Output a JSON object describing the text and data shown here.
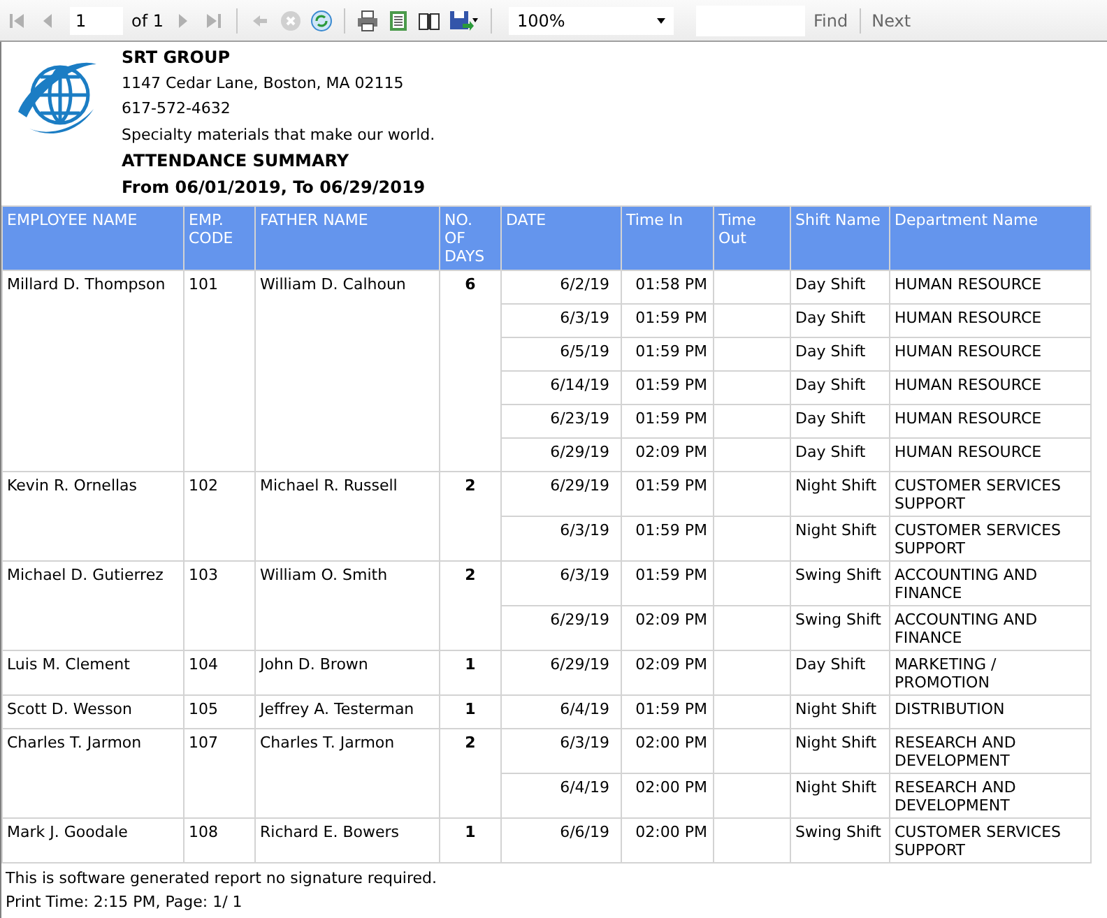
{
  "toolbar": {
    "page": "1",
    "page_count": "of 1",
    "zoom": "100%",
    "find": "Find",
    "next": "Next"
  },
  "header": {
    "company": "SRT GROUP",
    "address": "1147 Cedar Lane, Boston, MA 02115",
    "phone": "617-572-4632",
    "tagline": "Specialty materials that make our world.",
    "title": "ATTENDANCE SUMMARY",
    "period": "From 06/01/2019, To 06/29/2019"
  },
  "table": {
    "columns": [
      "EMPLOYEE NAME",
      "EMP. CODE",
      "FATHER NAME",
      "NO. OF DAYS",
      "DATE",
      "Time In",
      "Time Out",
      "Shift Name",
      "Department Name"
    ],
    "employees": [
      {
        "name": "Millard D. Thompson",
        "code": "101",
        "father": "William D. Calhoun",
        "days": "6",
        "records": [
          {
            "date": "6/2/19",
            "time_in": "01:58 PM",
            "shift": "Day Shift",
            "department": "HUMAN RESOURCE"
          },
          {
            "date": "6/3/19",
            "time_in": "01:59 PM",
            "shift": "Day Shift",
            "department": "HUMAN RESOURCE"
          },
          {
            "date": "6/5/19",
            "time_in": "01:59 PM",
            "shift": "Day Shift",
            "department": "HUMAN RESOURCE"
          },
          {
            "date": "6/14/19",
            "time_in": "01:59 PM",
            "shift": "Day Shift",
            "department": "HUMAN RESOURCE"
          },
          {
            "date": "6/23/19",
            "time_in": "01:59 PM",
            "shift": "Day Shift",
            "department": "HUMAN RESOURCE"
          },
          {
            "date": "6/29/19",
            "time_in": "02:09 PM",
            "shift": "Day Shift",
            "department": "HUMAN RESOURCE"
          }
        ]
      },
      {
        "name": "Kevin R. Ornellas",
        "code": "102",
        "father": "Michael R. Russell",
        "days": "2",
        "records": [
          {
            "date": "6/29/19",
            "time_in": "01:59 PM",
            "shift": "Night Shift",
            "department": "CUSTOMER SERVICES SUPPORT"
          },
          {
            "date": "6/3/19",
            "time_in": "01:59 PM",
            "shift": "Night Shift",
            "department": "CUSTOMER SERVICES SUPPORT"
          }
        ]
      },
      {
        "name": "Michael D. Gutierrez",
        "code": "103",
        "father": "William O. Smith",
        "days": "2",
        "records": [
          {
            "date": "6/3/19",
            "time_in": "01:59 PM",
            "shift": "Swing Shift",
            "department": "ACCOUNTING AND FINANCE"
          },
          {
            "date": "6/29/19",
            "time_in": "02:09 PM",
            "shift": "Swing Shift",
            "department": "ACCOUNTING AND FINANCE"
          }
        ]
      },
      {
        "name": "Luis M. Clement",
        "code": "104",
        "father": "John D. Brown",
        "days": "1",
        "records": [
          {
            "date": "6/29/19",
            "time_in": "02:09 PM",
            "shift": "Day Shift",
            "department": "MARKETING / PROMOTION"
          }
        ]
      },
      {
        "name": "Scott D. Wesson",
        "code": "105",
        "father": "Jeffrey A. Testerman",
        "days": "1",
        "records": [
          {
            "date": "6/4/19",
            "time_in": "01:59 PM",
            "shift": "Night Shift",
            "department": "DISTRIBUTION"
          }
        ]
      },
      {
        "name": "Charles T. Jarmon",
        "code": "107",
        "father": "Charles T. Jarmon",
        "days": "2",
        "records": [
          {
            "date": "6/3/19",
            "time_in": "02:00 PM",
            "shift": "Night Shift",
            "department": "RESEARCH AND DEVELOPMENT"
          },
          {
            "date": "6/4/19",
            "time_in": "02:00 PM",
            "shift": "Night Shift",
            "department": "RESEARCH AND DEVELOPMENT"
          }
        ]
      },
      {
        "name": "Mark J. Goodale",
        "code": "108",
        "father": "Richard E. Bowers",
        "days": "1",
        "records": [
          {
            "date": "6/6/19",
            "time_in": "02:00 PM",
            "shift": "Swing Shift",
            "department": "CUSTOMER SERVICES SUPPORT"
          }
        ]
      }
    ]
  },
  "footer": {
    "note": "This is software generated report no signature required.",
    "print_time": "Print Time: 2:15 PM, Page: 1/ 1"
  }
}
